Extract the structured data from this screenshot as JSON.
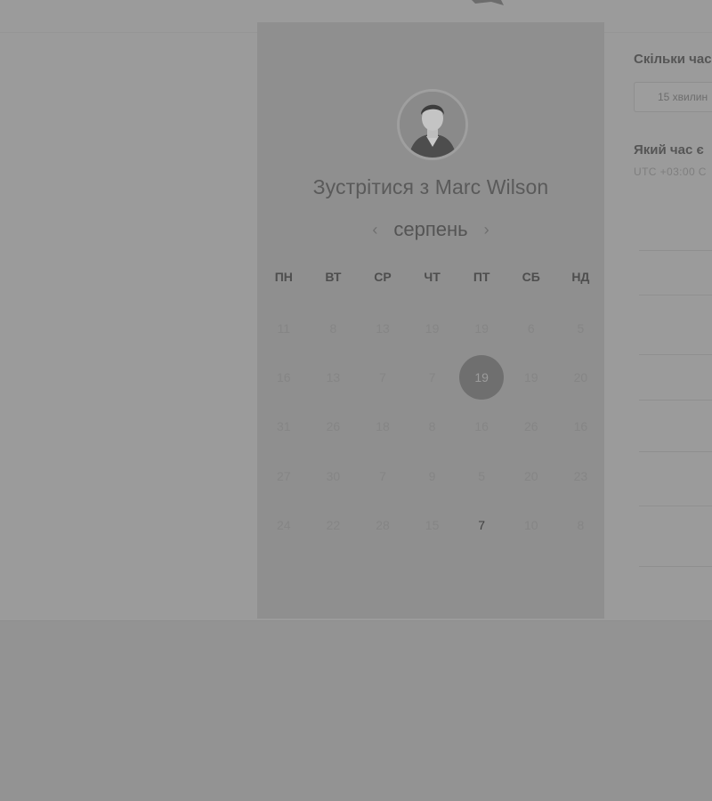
{
  "card": {
    "title": "Зустрітися з Marc Wilson",
    "month": "серпень",
    "prev_icon": "chevron-left-icon",
    "next_icon": "chevron-right-icon",
    "weekdays": [
      "ПН",
      "ВТ",
      "СР",
      "ЧТ",
      "ПТ",
      "СБ",
      "НД"
    ],
    "weeks": [
      [
        "11",
        "8",
        "13",
        "19",
        "19",
        "6",
        "5"
      ],
      [
        "16",
        "13",
        "7",
        "7",
        "19",
        "19",
        "20"
      ],
      [
        "31",
        "26",
        "18",
        "8",
        "16",
        "26",
        "16"
      ],
      [
        "27",
        "30",
        "7",
        "9",
        "5",
        "20",
        "23"
      ],
      [
        "24",
        "22",
        "28",
        "15",
        "7",
        "10",
        "8"
      ]
    ],
    "selected": {
      "week": 1,
      "day": 4
    },
    "available": [
      {
        "week": 4,
        "day": 4
      }
    ]
  },
  "right_panel": {
    "duration_question": "Скільки час",
    "duration_value": "15 хвилин",
    "time_question": "Який час є",
    "timezone": "UTC +03:00 C"
  },
  "colors": {
    "overlay": "#9b9b9b",
    "card": "#8f8f8f",
    "selected": "#6f6f6f"
  }
}
